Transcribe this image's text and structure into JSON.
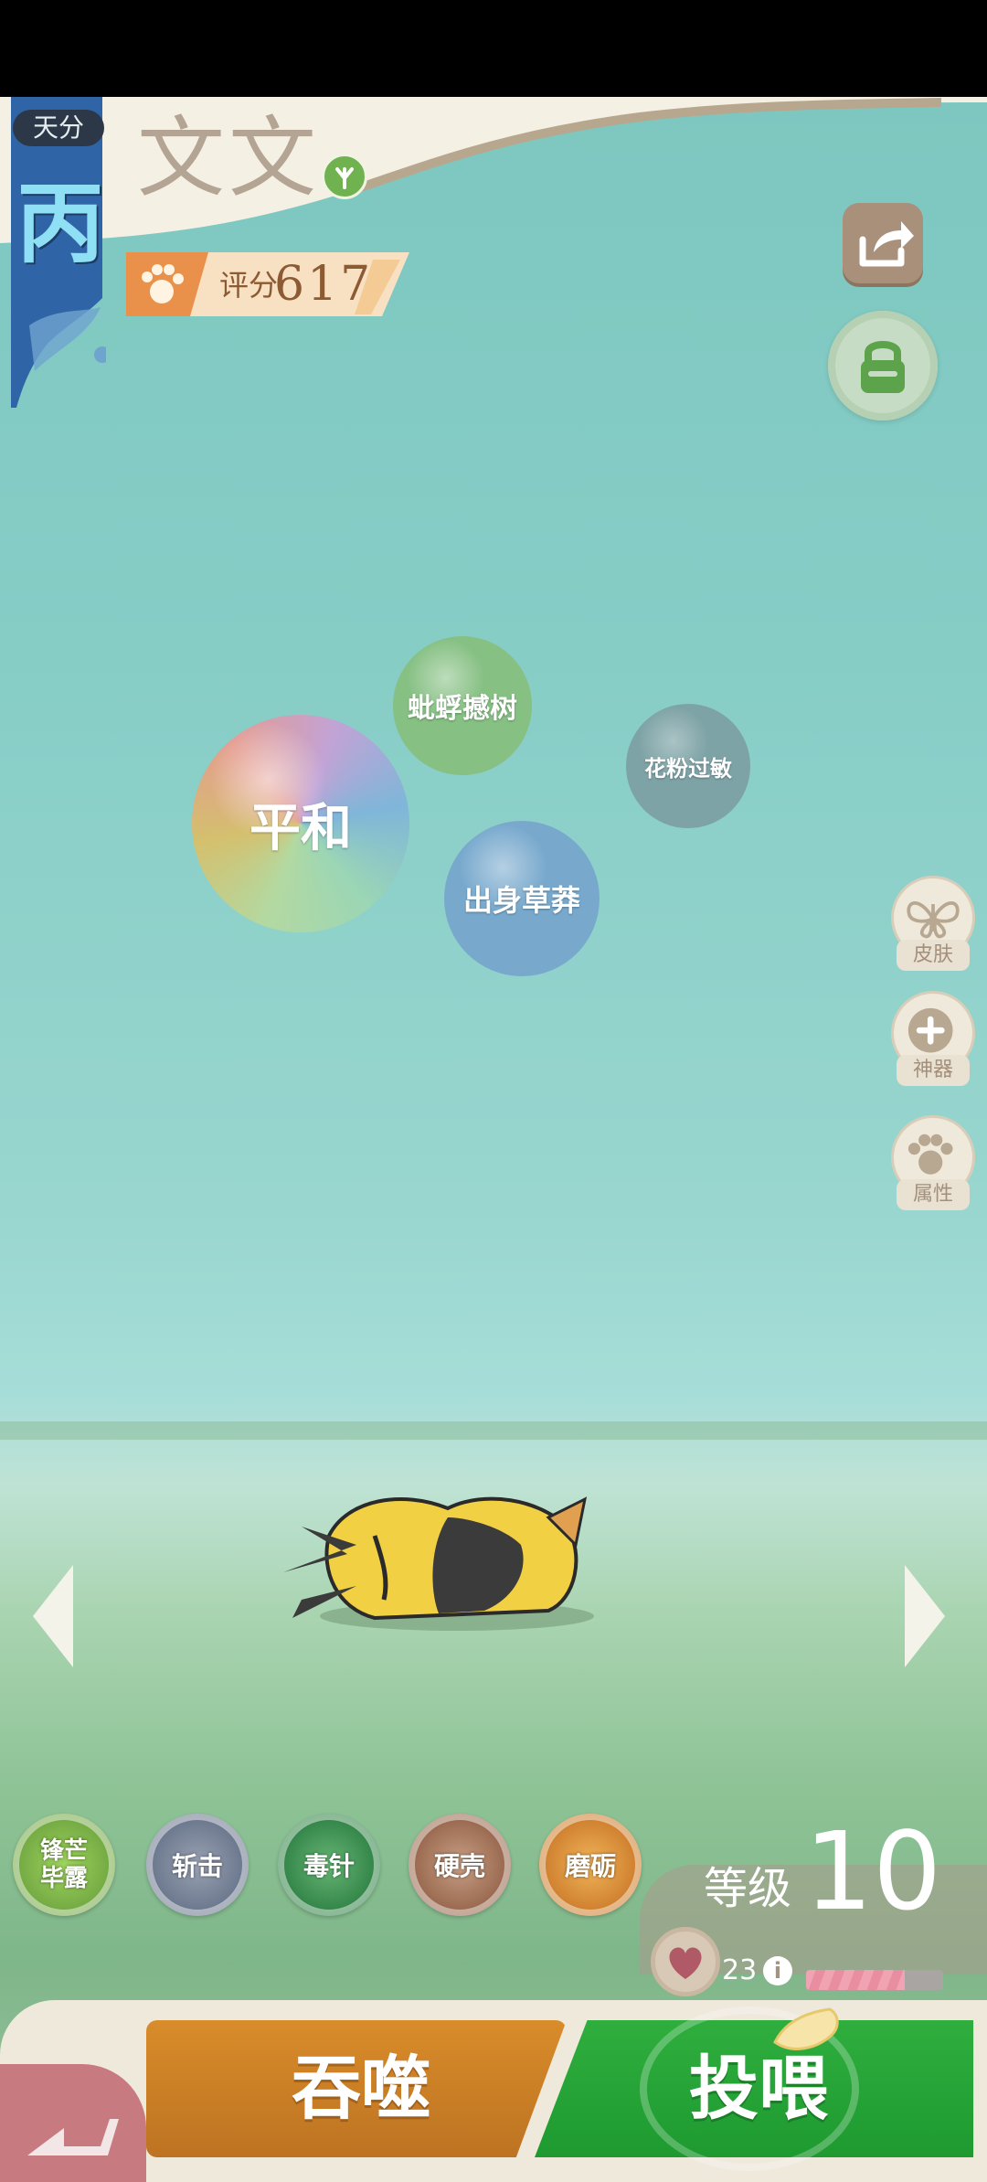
{
  "header": {
    "grade_label": "天分",
    "grade_value": "丙",
    "pet_name": "文文",
    "pet_type_icon": "leaf-type-icon",
    "score": {
      "label": "评分",
      "value": "617"
    }
  },
  "top_buttons": {
    "share_icon": "share-icon",
    "lock_icon": "lock-icon"
  },
  "bubbles": [
    {
      "label": "平和"
    },
    {
      "label": "蚍蜉撼树"
    },
    {
      "label": "花粉过敏"
    },
    {
      "label": "出身草莽"
    }
  ],
  "side_menu": [
    {
      "label": "皮肤",
      "icon": "butterfly-icon"
    },
    {
      "label": "神器",
      "icon": "plus-icon"
    },
    {
      "label": "属性",
      "icon": "paw-icon"
    }
  ],
  "skills": [
    {
      "label": "锋芒毕露",
      "label_line1": "锋芒",
      "label_line2": "毕露",
      "color": "#7fb84a"
    },
    {
      "label": "斩击",
      "color": "#7a869b"
    },
    {
      "label": "毒针",
      "color": "#3f9155"
    },
    {
      "label": "硬壳",
      "color": "#a87458"
    },
    {
      "label": "磨砺",
      "color": "#e0963a"
    }
  ],
  "level": {
    "label": "等级",
    "value": "10"
  },
  "health": {
    "value": "23",
    "fill_fraction": 0.72
  },
  "actions": {
    "devour_label": "吞噬",
    "feed_label": "投喂"
  },
  "colors": {
    "sky": "#7cc6bf",
    "devour": "#d98c2a",
    "feed": "#2fae3e",
    "back_tab": "#c77a7f"
  }
}
